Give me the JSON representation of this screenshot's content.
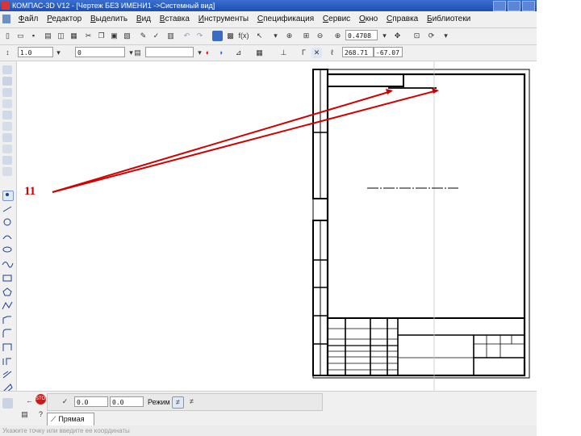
{
  "window": {
    "title": "КОМПАС-3D V12 - [Чертеж БЕЗ ИМЕНИ1 ->Системный вид]"
  },
  "menu": [
    "Файл",
    "Редактор",
    "Выделить",
    "Вид",
    "Вставка",
    "Инструменты",
    "Спецификация",
    "Сервис",
    "Окно",
    "Справка",
    "Библиотеки"
  ],
  "toolbar": {
    "zoom_value": "0.4708",
    "function_label": "f(x)"
  },
  "format_bar": {
    "style_value": "1.0",
    "layer_value": "0",
    "coord_x": "268.71",
    "coord_y": "-67.07"
  },
  "annotation": {
    "label": "11",
    "arrow_color": "#d40000"
  },
  "drawing": {
    "frame_color": "#000000"
  },
  "input_panel": {
    "value_1": "0.0",
    "value_2": "0.0",
    "mode_label": "Режим",
    "tab_label": "Прямая"
  },
  "status": {
    "hint": "Укажите точку или введите ее координаты"
  }
}
